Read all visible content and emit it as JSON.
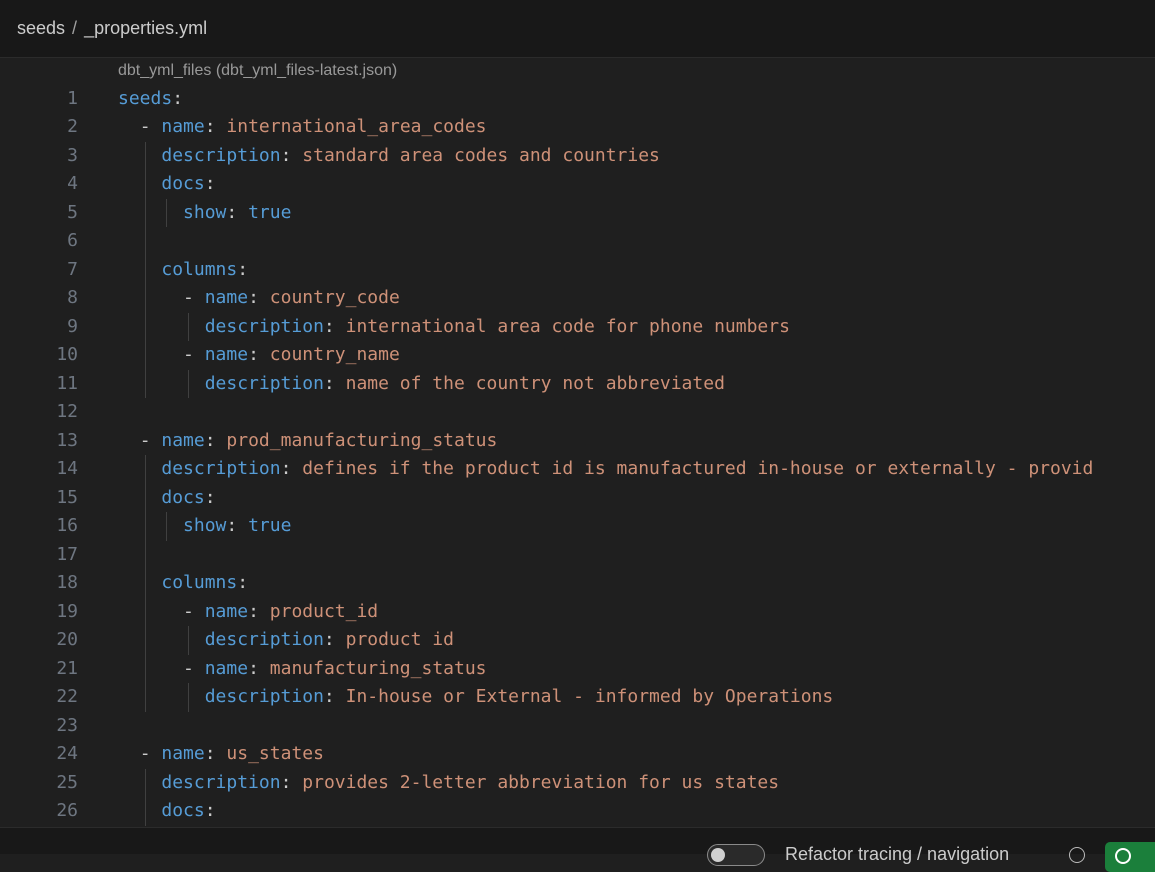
{
  "breadcrumb": {
    "folder": "seeds",
    "separator": "/",
    "file": "_properties.yml"
  },
  "editor": {
    "schema_hint": "dbt_yml_files (dbt_yml_files-latest.json)",
    "lines": [
      {
        "n": "1",
        "text": "seeds:"
      },
      {
        "n": "2",
        "text": "  - name: international_area_codes"
      },
      {
        "n": "3",
        "text": "    description: standard area codes and countries"
      },
      {
        "n": "4",
        "text": "    docs:"
      },
      {
        "n": "5",
        "text": "      show: true"
      },
      {
        "n": "6",
        "text": ""
      },
      {
        "n": "7",
        "text": "    columns:"
      },
      {
        "n": "8",
        "text": "      - name: country_code"
      },
      {
        "n": "9",
        "text": "        description: international area code for phone numbers"
      },
      {
        "n": "10",
        "text": "      - name: country_name"
      },
      {
        "n": "11",
        "text": "        description: name of the country not abbreviated"
      },
      {
        "n": "12",
        "text": ""
      },
      {
        "n": "13",
        "text": "  - name: prod_manufacturing_status"
      },
      {
        "n": "14",
        "text": "    description: defines if the product id is manufactured in-house or externally - provid"
      },
      {
        "n": "15",
        "text": "    docs:"
      },
      {
        "n": "16",
        "text": "      show: true"
      },
      {
        "n": "17",
        "text": ""
      },
      {
        "n": "18",
        "text": "    columns:"
      },
      {
        "n": "19",
        "text": "      - name: product_id"
      },
      {
        "n": "20",
        "text": "        description: product id"
      },
      {
        "n": "21",
        "text": "      - name: manufacturing_status"
      },
      {
        "n": "22",
        "text": "        description: In-house or External - informed by Operations"
      },
      {
        "n": "23",
        "text": ""
      },
      {
        "n": "24",
        "text": "  - name: us_states"
      },
      {
        "n": "25",
        "text": "    description: provides 2-letter abbreviation for us states"
      },
      {
        "n": "26",
        "text": "    docs:"
      }
    ]
  },
  "statusbar": {
    "label": "Refactor tracing / navigation"
  },
  "colors": {
    "key": "#569cd6",
    "value": "#ce9178",
    "punct": "#cccccc",
    "line_number": "#6e7681",
    "background": "#1f1f1f"
  },
  "icons": {
    "help": "help-circle-icon",
    "status": "check-circle-icon"
  }
}
